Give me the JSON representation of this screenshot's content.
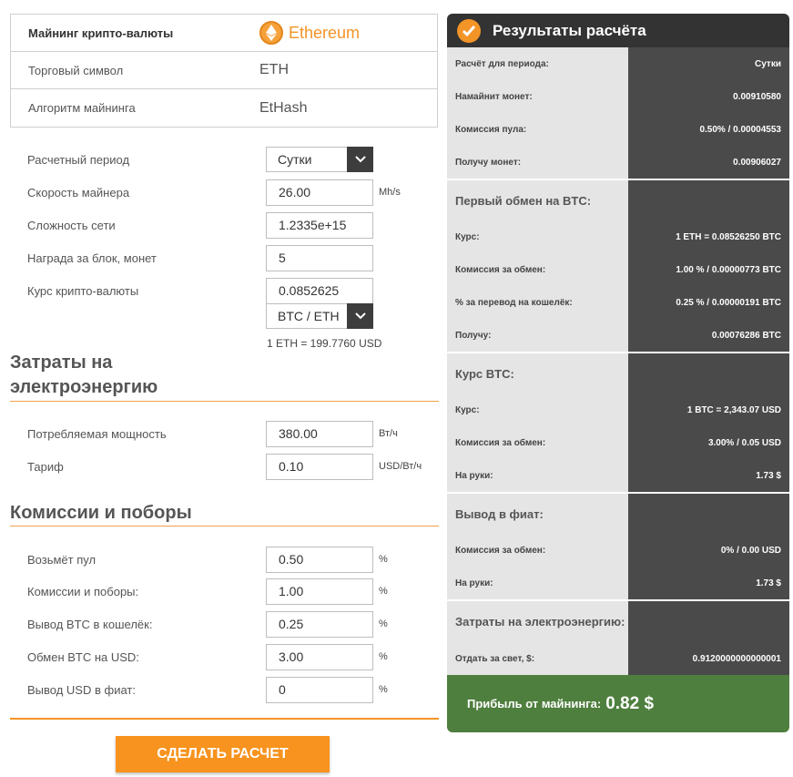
{
  "coin": {
    "title_label": "Майнинг крипто-валюты",
    "name": "Ethereum",
    "symbol_label": "Торговый символ",
    "symbol": "ETH",
    "algo_label": "Алгоритм майнинга",
    "algo": "EtHash"
  },
  "form": {
    "period": {
      "label": "Расчетный период",
      "value": "Сутки"
    },
    "hashrate": {
      "label": "Скорость майнера",
      "value": "26.00",
      "unit": "Mh/s"
    },
    "difficulty": {
      "label": "Сложность сети",
      "value": "1.2335e+15"
    },
    "reward": {
      "label": "Награда за блок, монет",
      "value": "5"
    },
    "rate": {
      "label": "Курс крипто-валюты",
      "value": "0.0852625"
    },
    "pair": {
      "value": "BTC / ETH"
    },
    "rate_note": "1 ETH = 199.7760 USD"
  },
  "power": {
    "title_line1": "Затраты на",
    "title_line2": "электроэнергию",
    "consumption": {
      "label": "Потребляемая мощность",
      "value": "380.00",
      "unit": "Вт/ч"
    },
    "tariff": {
      "label": "Тариф",
      "value": "0.10",
      "unit": "USD/Вт/ч"
    }
  },
  "fees": {
    "title": "Комиссии и поборы",
    "pool": {
      "label": "Возьмёт пул",
      "value": "0.50",
      "unit": "%"
    },
    "misc": {
      "label": "Комиссии и поборы:",
      "value": "1.00",
      "unit": "%"
    },
    "btc_withdraw": {
      "label": "Вывод BTC в кошелёк:",
      "value": "0.25",
      "unit": "%"
    },
    "btc_usd": {
      "label": "Обмен BTC на USD:",
      "value": "3.00",
      "unit": "%"
    },
    "usd_fiat": {
      "label": "Вывод USD в фиат:",
      "value": "0",
      "unit": "%"
    }
  },
  "calc_button": "СДЕЛАТЬ РАСЧЕТ",
  "results": {
    "title": "Результаты расчёта",
    "g1": {
      "period_label": "Расчёт для периода:",
      "period": "Сутки",
      "mined_label": "Намайнит монет:",
      "mined": "0.00910580",
      "pool_label": "Комиссия пула:",
      "pool": "0.50% / 0.00004553",
      "get_label": "Получу монет:",
      "get": "0.00906027"
    },
    "g2": {
      "head": "Первый обмен на BTC:",
      "rate_label": "Курс:",
      "rate": "1 ETH = 0.08526250 BTC",
      "fee_label": "Комиссия за обмен:",
      "fee": "1.00 % / 0.00000773 BTC",
      "wallet_label": "% за перевод на кошелёк:",
      "wallet": "0.25 % / 0.00000191 BTC",
      "get_label": "Получу:",
      "get": "0.00076286 BTC"
    },
    "g3": {
      "head": "Курс BTC:",
      "rate_label": "Курс:",
      "rate": "1 BTC = 2,343.07 USD",
      "fee_label": "Комиссия за обмен:",
      "fee": "3.00% / 0.05 USD",
      "hand_label": "На руки:",
      "hand": "1.73 $"
    },
    "g4": {
      "head": "Вывод в фиат:",
      "fee_label": "Комиссия за обмен:",
      "fee": "0% / 0.00 USD",
      "hand_label": "На руки:",
      "hand": "1.73 $"
    },
    "g5": {
      "head": "Затраты на электроэнергию:",
      "pay_label": "Отдать за свет, $:",
      "pay": "0.9120000000000001"
    },
    "profit_label": "Прибыль от майнинга:",
    "profit": "0.82 $"
  },
  "colors": {
    "accent": "#f39427",
    "panel_dark": "#4a4a4a",
    "panel_light": "#e5e5e5",
    "profit_green": "#4f7f3e"
  }
}
